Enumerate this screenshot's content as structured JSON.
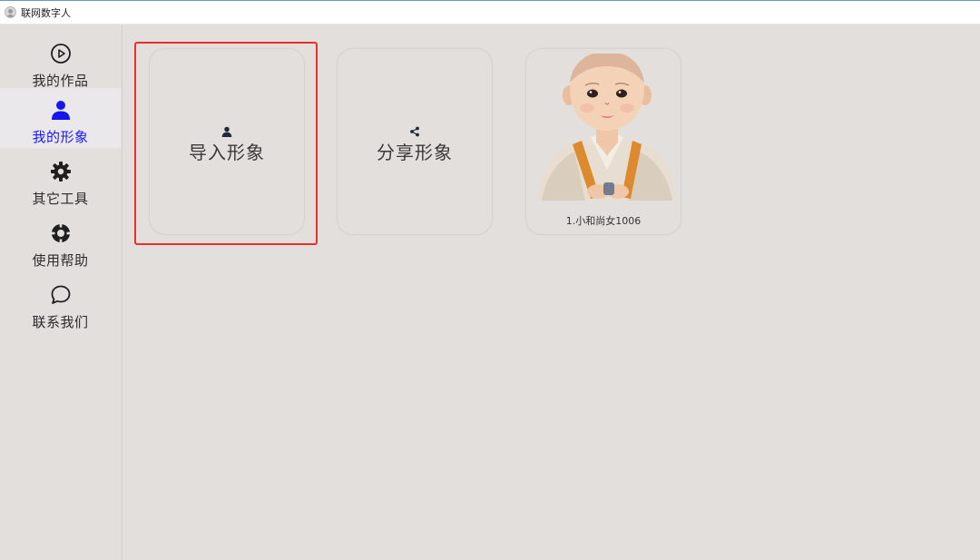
{
  "window": {
    "title": "联网数字人"
  },
  "sidebar": {
    "items": [
      {
        "label": "我的作品",
        "icon": "play-circle-icon",
        "active": false
      },
      {
        "label": "我的形象",
        "icon": "person-icon",
        "active": true
      },
      {
        "label": "其它工具",
        "icon": "gear-icon",
        "active": false
      },
      {
        "label": "使用帮助",
        "icon": "lifebuoy-icon",
        "active": false
      },
      {
        "label": "联系我们",
        "icon": "chat-bubble-icon",
        "active": false
      }
    ]
  },
  "main": {
    "import_card": {
      "label": "导入形象",
      "icon": "person-icon"
    },
    "share_card": {
      "label": "分享形象",
      "icon": "share-icon"
    },
    "avatars": [
      {
        "caption": "1.小和尚女1006"
      }
    ]
  },
  "colors": {
    "background": "#e3dfdc",
    "active_nav_text": "#1a1af0",
    "active_nav_bg": "#eae8eb",
    "highlight_border": "#ea2d2d",
    "icon_dark": "#1f2a3a"
  }
}
